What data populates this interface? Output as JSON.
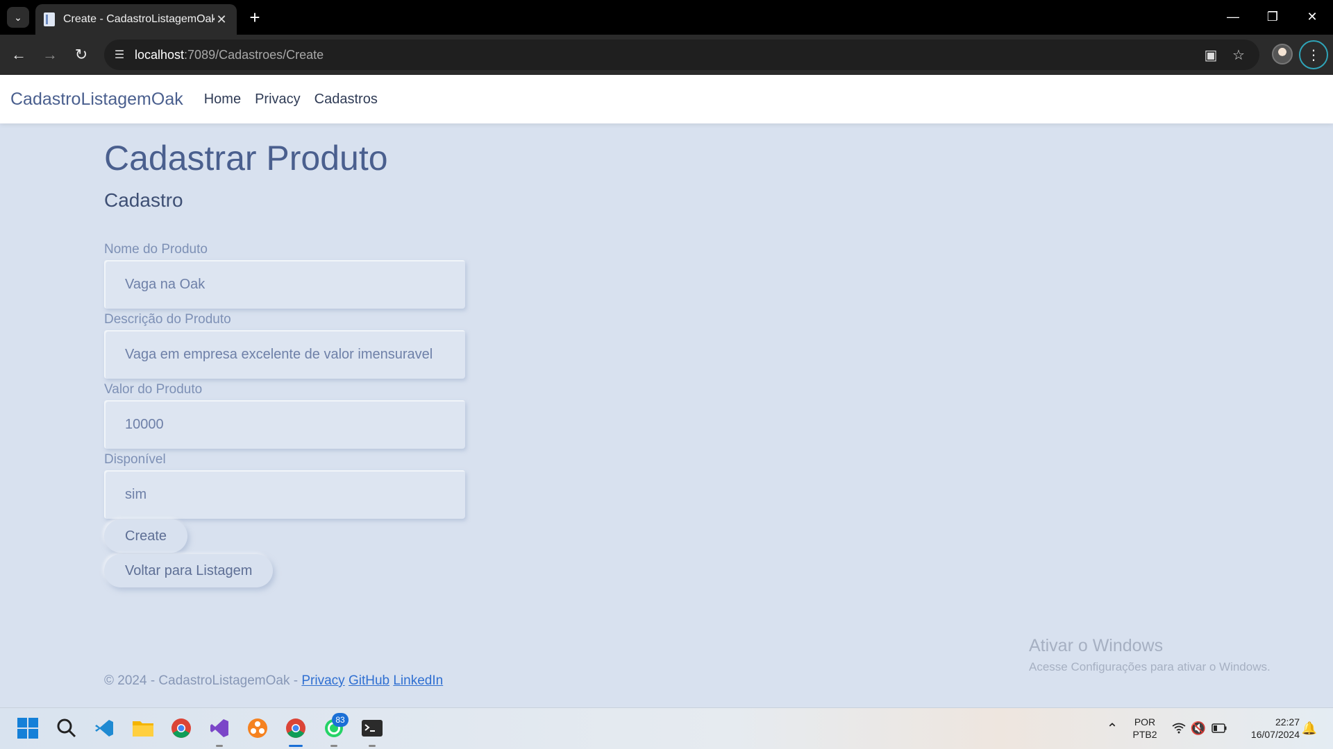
{
  "browser": {
    "tab_title": "Create - CadastroListagemOak",
    "url_host": "localhost",
    "url_rest": ":7089/Cadastroes/Create"
  },
  "site": {
    "brand": "CadastroListagemOak",
    "nav": [
      "Home",
      "Privacy",
      "Cadastros"
    ]
  },
  "page": {
    "title": "Cadastrar Produto",
    "subtitle": "Cadastro",
    "fields": [
      {
        "label": "Nome do Produto",
        "value": "Vaga na Oak"
      },
      {
        "label": "Descrição do Produto",
        "value": "Vaga em empresa excelente de valor imensuravel"
      },
      {
        "label": "Valor do Produto",
        "value": "10000"
      },
      {
        "label": "Disponível",
        "value": "sim"
      }
    ],
    "create_button": "Create",
    "back_button": "Voltar para Listagem"
  },
  "footer": {
    "copyright": "© 2024 - CadastroListagemOak - ",
    "links": [
      "Privacy",
      "GitHub",
      "LinkedIn"
    ]
  },
  "watermark": {
    "title": "Ativar o Windows",
    "subtitle": "Acesse Configurações para ativar o Windows."
  },
  "taskbar": {
    "whatsapp_badge": "83",
    "lang_1": "POR",
    "lang_2": "PTB2",
    "time": "22:27",
    "date": "16/07/2024"
  },
  "colors": {
    "accent": "#4a5f8e",
    "background": "#d8e1ef",
    "link": "#2f6fd1"
  }
}
